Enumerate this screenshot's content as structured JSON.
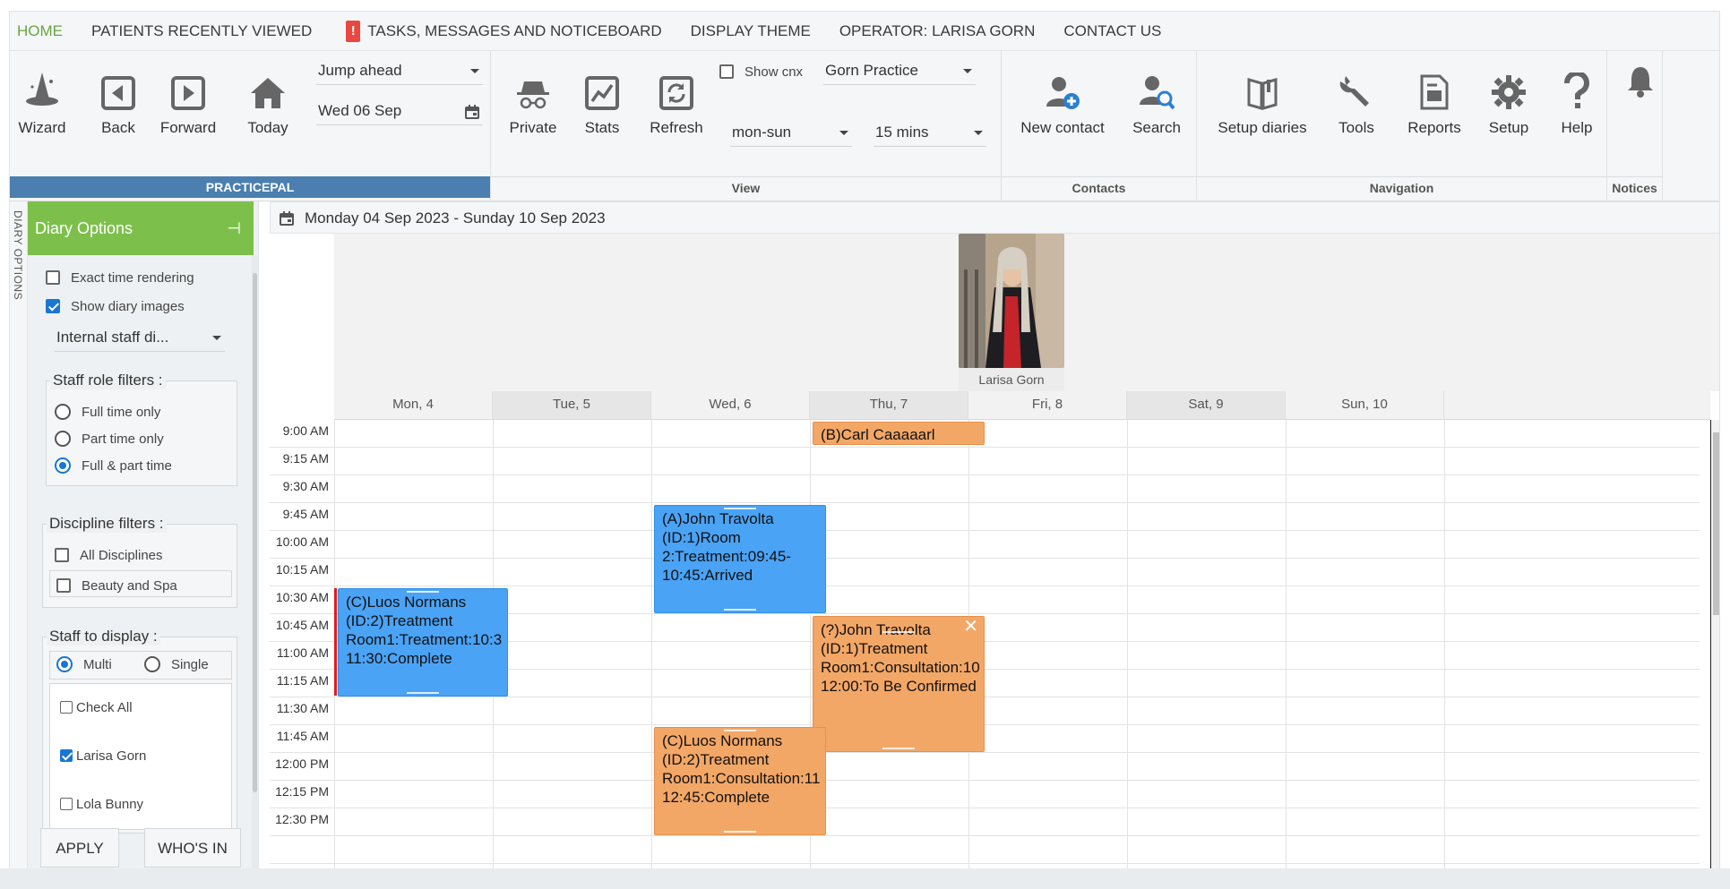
{
  "topmenu": {
    "home": "HOME",
    "patients": "PATIENTS RECENTLY VIEWED",
    "tasks_alert": "!",
    "tasks": "TASKS, MESSAGES AND NOTICEBOARD",
    "theme": "DISPLAY THEME",
    "operator": "OPERATOR: LARISA GORN",
    "contact": "CONTACT US"
  },
  "ribbon": {
    "wizard": "Wizard",
    "back": "Back",
    "forward": "Forward",
    "today": "Today",
    "jump_ahead": "Jump ahead",
    "date": "Wed 06 Sep",
    "private": "Private",
    "stats": "Stats",
    "refresh": "Refresh",
    "show_cnx": "Show cnx",
    "practice": "Gorn Practice",
    "days": "mon-sun",
    "interval": "15 mins",
    "new_contact": "New contact",
    "search": "Search",
    "setup_diaries": "Setup diaries",
    "tools": "Tools",
    "reports": "Reports",
    "setup": "Setup",
    "help": "Help",
    "groups": {
      "practicepal": "PRACTICEPAL",
      "view": "View",
      "contacts": "Contacts",
      "navigation": "Navigation",
      "notices": "Notices"
    }
  },
  "sidebar": {
    "vertical_tab": "DIARY OPTIONS",
    "title": "Diary Options",
    "exact_time": "Exact time rendering",
    "show_images": "Show diary images",
    "diary_select": "Internal staff di...",
    "staff_role_title": "Staff role filters :",
    "full_time": "Full time only",
    "part_time": "Part time only",
    "full_part": "Full & part time",
    "discipline_title": "Discipline filters :",
    "all_disciplines": "All Disciplines",
    "beauty_spa": "Beauty and Spa",
    "staff_display_title": "Staff to display :",
    "multi": "Multi",
    "single": "Single",
    "check_all": "Check All",
    "staff": [
      "Larisa Gorn",
      "Lola Bunny"
    ],
    "apply": "APPLY",
    "whos_in": "WHO'S IN"
  },
  "calendar": {
    "range": "Monday 04 Sep 2023 - Sunday 10 Sep 2023",
    "staff_name": "Larisa Gorn",
    "days": [
      "Mon, 4",
      "Tue, 5",
      "Wed, 6",
      "Thu, 7",
      "Fri, 8",
      "Sat, 9",
      "Sun, 10"
    ],
    "times": [
      "9:00 AM",
      "9:15 AM",
      "9:30 AM",
      "9:45 AM",
      "10:00 AM",
      "10:15 AM",
      "10:30 AM",
      "10:45 AM",
      "11:00 AM",
      "11:15 AM",
      "11:30 AM",
      "11:45 AM",
      "12:00 PM",
      "12:15 PM",
      "12:30 PM"
    ],
    "appointments": [
      {
        "text": "(B)Carl Caaaaarl",
        "day": "Thu, 7",
        "color": "#f3a766"
      },
      {
        "text": "(A)John Travolta (ID:1)Room 2:Treatment:09:45-10:45:Arrived",
        "day": "Wed, 6",
        "color": "#4aa3f5"
      },
      {
        "text": "(C)Luos Normans (ID:2)Treatment Room1:Treatment:10:3 11:30:Complete",
        "day": "Mon, 4",
        "color": "#4aa3f5"
      },
      {
        "text": "(?)John Travolta (ID:1)Treatment Room1:Consultation:10 12:00:To Be Confirmed",
        "day": "Thu, 7",
        "color": "#f3a766"
      },
      {
        "text": "(C)Luos Normans (ID:2)Treatment Room1:Consultation:11 12:45:Complete",
        "day": "Wed, 6",
        "color": "#f3a766"
      }
    ]
  }
}
